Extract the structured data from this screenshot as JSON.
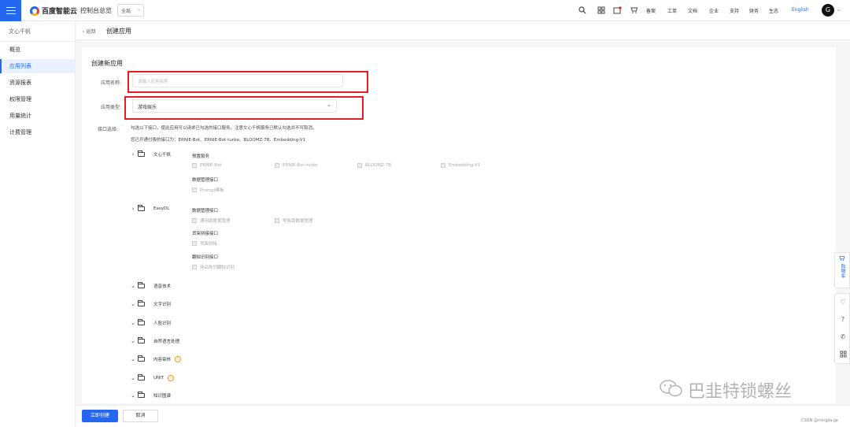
{
  "topbar": {
    "brand": "百度智能云",
    "console": "控制台总览",
    "region": "全局",
    "icons": [
      "search-icon",
      "grid-icon",
      "message-icon",
      "cart-icon"
    ],
    "links": [
      "备案",
      "工单",
      "文档",
      "企业",
      "支持",
      "财务",
      "生态"
    ],
    "language": "English",
    "avatar_letter": "G"
  },
  "sidebar": {
    "title": "文心千帆",
    "items": [
      {
        "label": "概览",
        "active": false
      },
      {
        "label": "应用列表",
        "active": true
      },
      {
        "label": "资源报表",
        "active": false
      },
      {
        "label": "权限管理",
        "active": false
      },
      {
        "label": "用量统计",
        "active": false
      },
      {
        "label": "计费管理",
        "active": false
      }
    ]
  },
  "header": {
    "back_label": "返回",
    "title": "创建应用"
  },
  "form": {
    "heading": "创建新应用",
    "name_label": "应用名称:",
    "name_placeholder": "请输入应用名称",
    "type_label": "应用类型:",
    "type_value": "游戏娱乐",
    "api_label": "接口选择:",
    "hint1": "勾选以下接口，使此应用可以请求已勾选的接口服务。注意文心千帆服务已默认勾选并不可取消。",
    "hint2": "您已开通付费的接口为：ERNIE-Bot、ERNIE-Bot-turbo、BLOOMZ-7B、Embedding-V1"
  },
  "tree": {
    "wenxin": {
      "label": "文心千帆",
      "group1": "预置服务",
      "services": [
        "ERNIE-Bot",
        "ERNIE-Bot-turbo",
        "BLOOMZ-7B",
        "Embedding-V1"
      ],
      "group2": "数据管理接口",
      "prompt": "Prompt模板"
    },
    "easydl": {
      "label": "EasyDL",
      "group1": "数据管理接口",
      "items1": [
        "通用版数据管理",
        "零售版数据管理"
      ],
      "group2": "货架拼接接口",
      "items2": [
        "货架拼接"
      ],
      "group3": "翻拍识别接口",
      "items3": [
        "商品陈列翻拍识别"
      ]
    },
    "collapsed": [
      "语音技术",
      "文字识别",
      "人脸识别",
      "自然语言处理",
      "内容审核",
      "UNIT",
      "知识图谱"
    ]
  },
  "footer": {
    "create": "立即创建",
    "cancel": "取消"
  },
  "float": {
    "cart": "购物车"
  },
  "watermark": "巴韭特锁螺丝",
  "csdn": "CSDN @mingjia.ge",
  "colors": {
    "accent": "#2468f2",
    "highlight": "#e02020",
    "warning": "#f39c12"
  }
}
